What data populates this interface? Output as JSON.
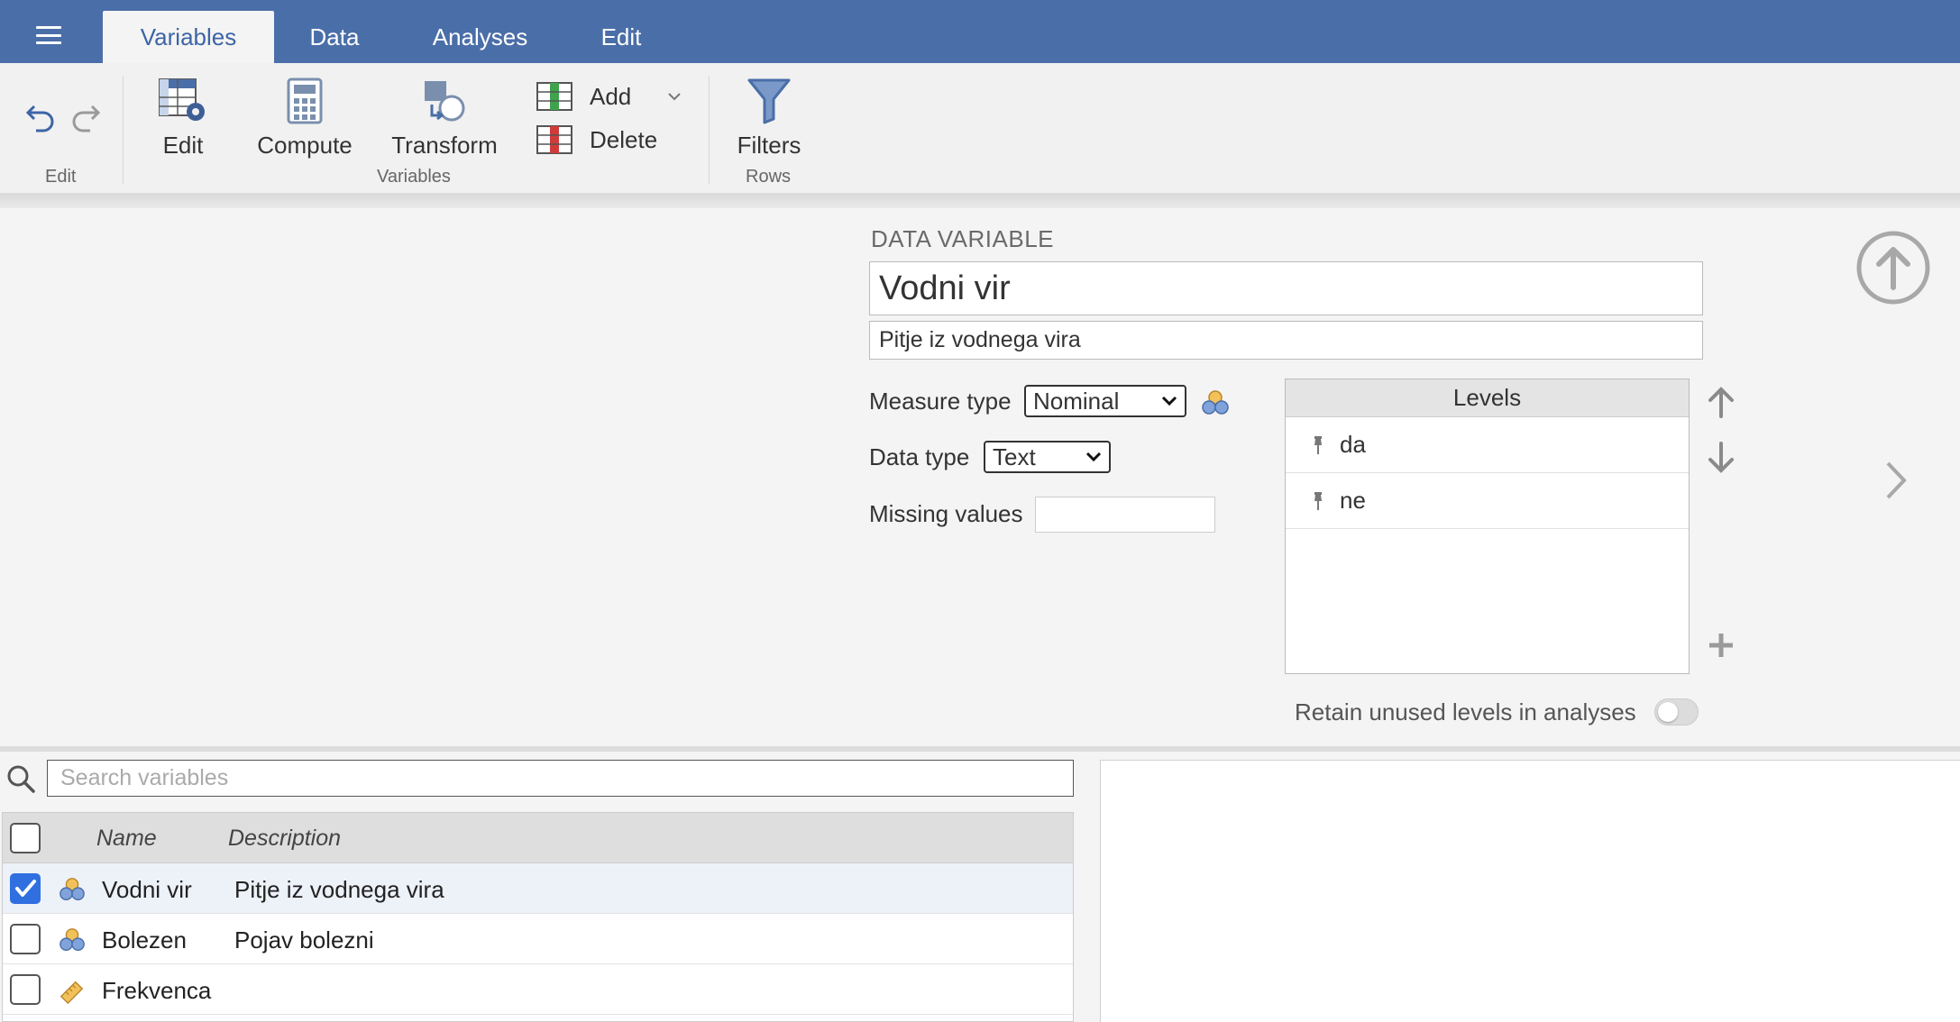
{
  "tabs": [
    {
      "label": "Variables",
      "active": true
    },
    {
      "label": "Data",
      "active": false
    },
    {
      "label": "Analyses",
      "active": false
    },
    {
      "label": "Edit",
      "active": false
    }
  ],
  "ribbon": {
    "edit_button": "Edit",
    "compute_button": "Compute",
    "transform_button": "Transform",
    "add_button": "Add",
    "delete_button": "Delete",
    "filters_button": "Filters",
    "group_edit": "Edit",
    "group_variables": "Variables",
    "group_rows": "Rows"
  },
  "variable_panel": {
    "section_title": "DATA VARIABLE",
    "name": "Vodni vir",
    "description": "Pitje iz vodnega vira",
    "measure_type_label": "Measure type",
    "measure_type_value": "Nominal",
    "data_type_label": "Data type",
    "data_type_value": "Text",
    "missing_values_label": "Missing values",
    "missing_values_value": "",
    "levels_header": "Levels",
    "levels": [
      "da",
      "ne"
    ],
    "retain_label": "Retain unused levels in analyses",
    "retain_on": false
  },
  "variables_list": {
    "search_placeholder": "Search variables",
    "columns": {
      "name": "Name",
      "description": "Description"
    },
    "rows": [
      {
        "name": "Vodni vir",
        "description": "Pitje iz vodnega vira",
        "icon": "nominal-icon",
        "checked": true
      },
      {
        "name": "Bolezen",
        "description": "Pojav bolezni",
        "icon": "nominal-icon",
        "checked": false
      },
      {
        "name": "Frekvenca",
        "description": "",
        "icon": "continuous-ruler-icon",
        "checked": false
      }
    ]
  },
  "colors": {
    "topbar": "#4a6ea8",
    "active_tab_text": "#3d65a6",
    "checkbox_checked": "#2f6fe0"
  }
}
